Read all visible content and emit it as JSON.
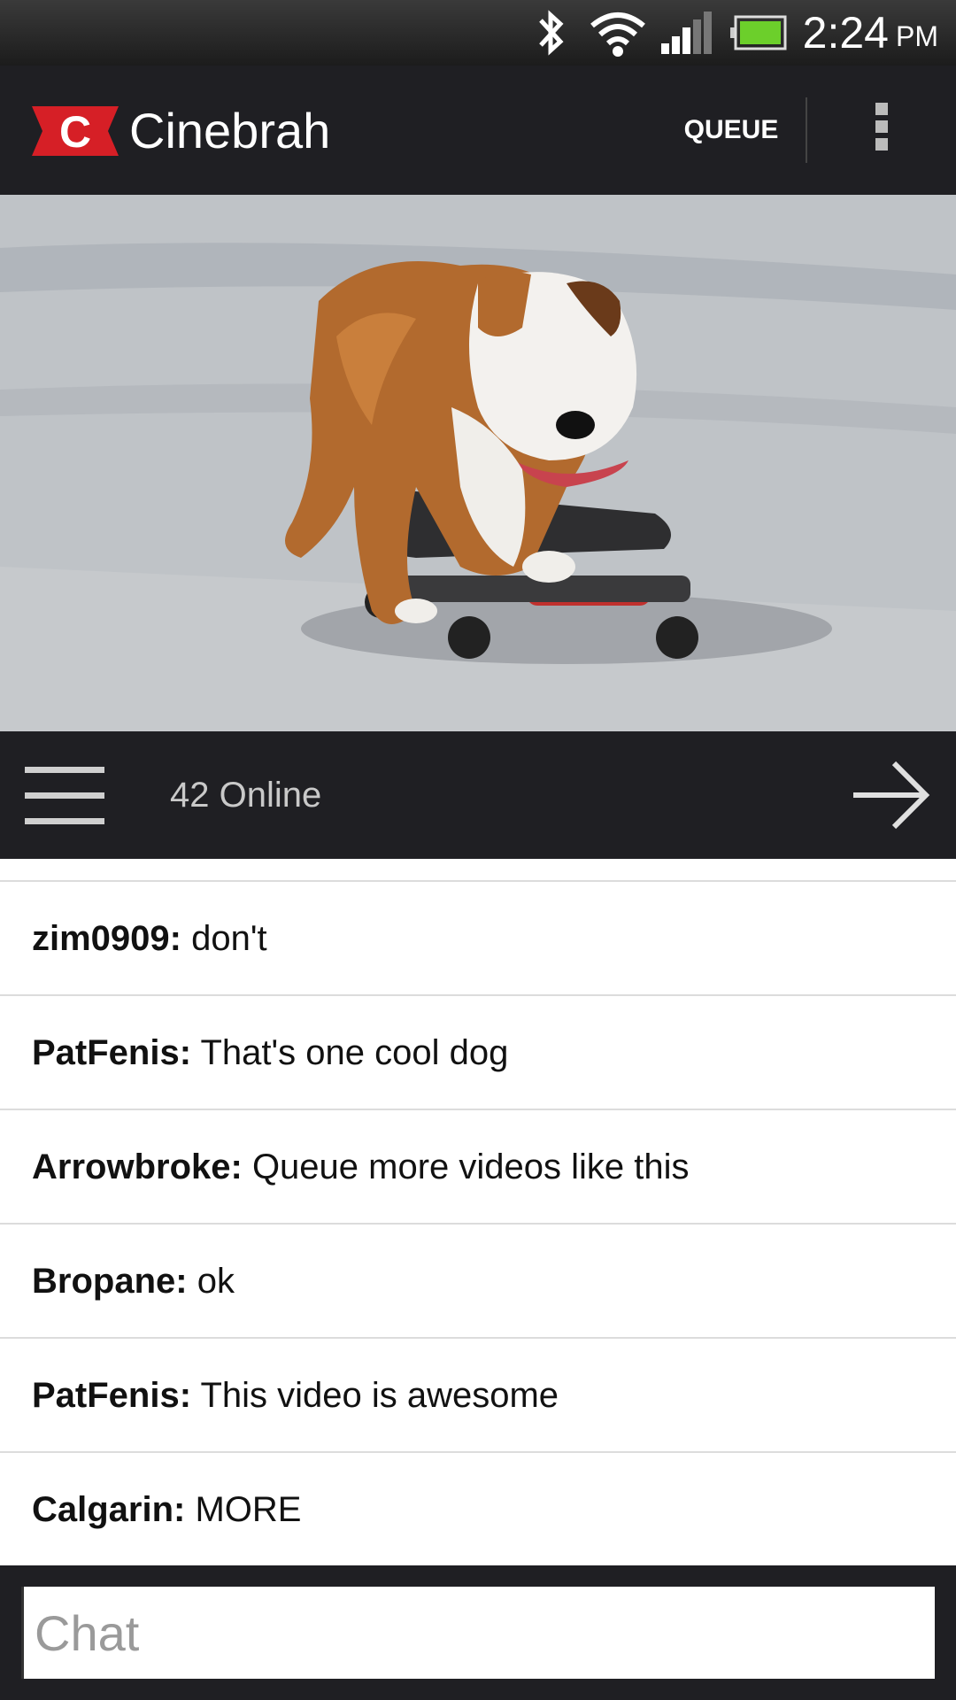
{
  "status_bar": {
    "time": "2:24",
    "ampm": "PM",
    "icons": [
      "bluetooth-icon",
      "wifi-icon",
      "signal-icon",
      "battery-icon"
    ]
  },
  "app_bar": {
    "title": "Cinebrah",
    "logo_letter": "C",
    "queue_label": "QUEUE",
    "overflow_icon": "overflow-menu-icon"
  },
  "video": {
    "description_icon": "video-player"
  },
  "chat_header": {
    "online_count": "42 Online",
    "menu_icon": "hamburger-menu-icon",
    "send_icon": "arrow-right-icon"
  },
  "chat": {
    "messages": [
      {
        "user": "zim0909:",
        "text": "don't"
      },
      {
        "user": "PatFenis:",
        "text": "That's one cool dog"
      },
      {
        "user": "Arrowbroke:",
        "text": "Queue more videos like this"
      },
      {
        "user": "Bropane:",
        "text": "ok"
      },
      {
        "user": "PatFenis:",
        "text": "This video is awesome"
      },
      {
        "user": "Calgarin:",
        "text": "MORE"
      }
    ]
  },
  "input": {
    "placeholder": "Chat",
    "value": ""
  },
  "colors": {
    "bar_background": "#1f1f23",
    "logo_red": "#d61f26",
    "divider": "#dcdcdc",
    "battery_green": "#6ccf2b"
  }
}
